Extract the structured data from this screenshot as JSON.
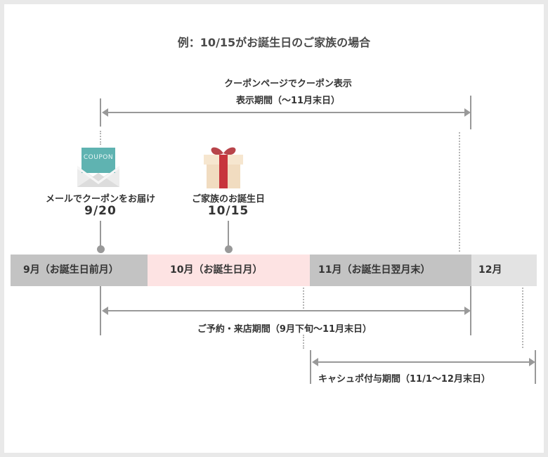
{
  "title": "例：10/15がお誕生日のご家族の場合",
  "coupon_display": {
    "line1": "クーポンページでクーポン表示",
    "line2": "表示期間（〜11月末日）"
  },
  "email_event": {
    "label": "メールでクーポンをお届け",
    "date": "9/20",
    "icon_text": "COUPON"
  },
  "birthday_event": {
    "label": "ご家族のお誕生日",
    "date": "10/15"
  },
  "timeline": [
    {
      "label": "9月（お誕生日前月）",
      "color": "#c3c3c3"
    },
    {
      "label": "10月（お誕生日月）",
      "color": "#fde3e3"
    },
    {
      "label": "11月（お誕生日翌月末）",
      "color": "#c3c3c3"
    },
    {
      "label": "12月",
      "color": "#e3e3e3"
    }
  ],
  "reservation_period": "ご予約・来店期間（9月下旬〜11月末日）",
  "cashback_period": "キャシュポ付与期間（11/1〜12月末日）"
}
